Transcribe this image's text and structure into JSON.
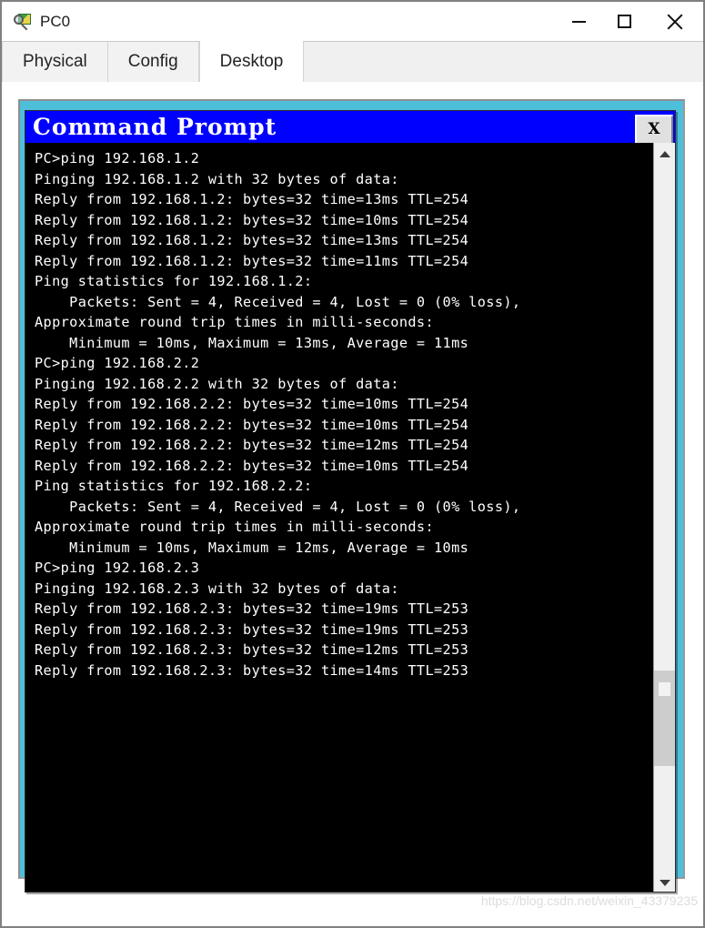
{
  "window": {
    "title": "PC0",
    "icon": "pc-inspect-icon",
    "controls": {
      "minimize_label": "—",
      "maximize_label": "☐",
      "close_label": "✕"
    }
  },
  "tabs": [
    {
      "label": "Physical",
      "active": false
    },
    {
      "label": "Config",
      "active": false
    },
    {
      "label": "Desktop",
      "active": true
    }
  ],
  "cmd_window": {
    "title": "Command Prompt",
    "close_label": "X",
    "scrollbar": {
      "up_label": "scroll-up",
      "down_label": "scroll-down",
      "thumb_label": "scroll-thumb"
    },
    "lines": [
      "PC>ping 192.168.1.2",
      "",
      "Pinging 192.168.1.2 with 32 bytes of data:",
      "",
      "Reply from 192.168.1.2: bytes=32 time=13ms TTL=254",
      "Reply from 192.168.1.2: bytes=32 time=10ms TTL=254",
      "Reply from 192.168.1.2: bytes=32 time=13ms TTL=254",
      "Reply from 192.168.1.2: bytes=32 time=11ms TTL=254",
      "",
      "Ping statistics for 192.168.1.2:",
      "    Packets: Sent = 4, Received = 4, Lost = 0 (0% loss),",
      "Approximate round trip times in milli-seconds:",
      "    Minimum = 10ms, Maximum = 13ms, Average = 11ms",
      "",
      "PC>ping 192.168.2.2",
      "",
      "Pinging 192.168.2.2 with 32 bytes of data:",
      "",
      "Reply from 192.168.2.2: bytes=32 time=10ms TTL=254",
      "Reply from 192.168.2.2: bytes=32 time=10ms TTL=254",
      "Reply from 192.168.2.2: bytes=32 time=12ms TTL=254",
      "Reply from 192.168.2.2: bytes=32 time=10ms TTL=254",
      "",
      "Ping statistics for 192.168.2.2:",
      "    Packets: Sent = 4, Received = 4, Lost = 0 (0% loss),",
      "Approximate round trip times in milli-seconds:",
      "    Minimum = 10ms, Maximum = 12ms, Average = 10ms",
      "",
      "PC>ping 192.168.2.3",
      "",
      "Pinging 192.168.2.3 with 32 bytes of data:",
      "",
      "Reply from 192.168.2.3: bytes=32 time=19ms TTL=253",
      "Reply from 192.168.2.3: bytes=32 time=19ms TTL=253",
      "Reply from 192.168.2.3: bytes=32 time=12ms TTL=253",
      "Reply from 192.168.2.3: bytes=32 time=14ms TTL=253"
    ]
  },
  "watermark": "https://blog.csdn.net/weixin_43379235",
  "colors": {
    "desktop_panel": "#4ebfdb",
    "cmd_titlebar": "#0000ff",
    "terminal_bg": "#000000",
    "terminal_fg": "#ffffff"
  }
}
